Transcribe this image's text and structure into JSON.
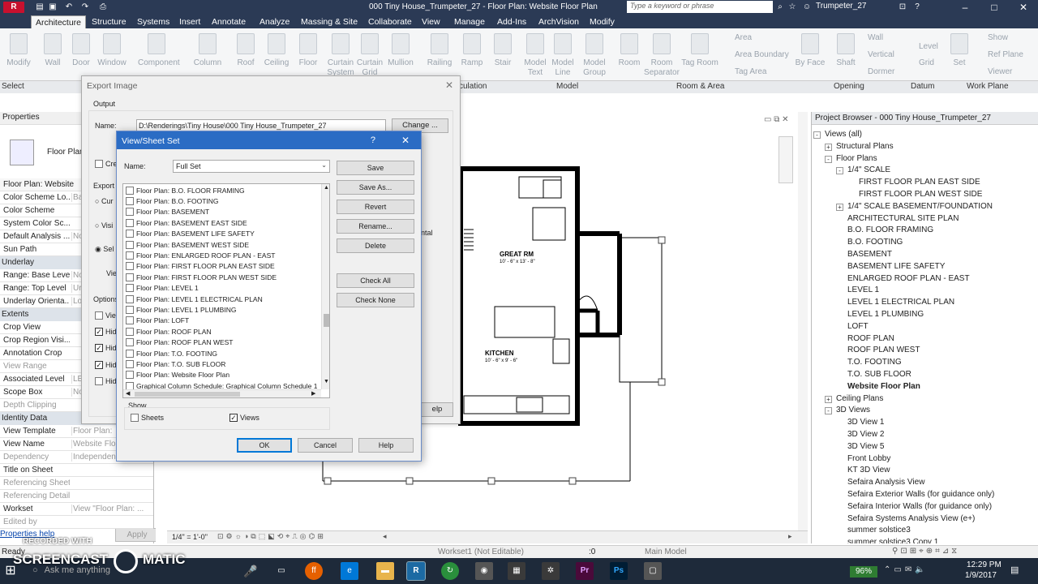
{
  "titlebar": {
    "title": "000 Tiny House_Trumpeter_27 - Floor Plan: Website Floor Plan",
    "search_placeholder": "Type a keyword or phrase",
    "user": "Trumpeter_27"
  },
  "tabs": [
    "Architecture",
    "Structure",
    "Systems",
    "Insert",
    "Annotate",
    "Analyze",
    "Massing & Site",
    "Collaborate",
    "View",
    "Manage",
    "Add-Ins",
    "ArchVision",
    "Modify"
  ],
  "ribbon": {
    "buttons": [
      "Modify",
      "Wall",
      "Door",
      "Window",
      "Component",
      "Column",
      "Roof",
      "Ceiling",
      "Floor",
      "Curtain System",
      "Curtain Grid",
      "Mullion",
      "Railing",
      "Ramp",
      "Stair",
      "Model Text",
      "Model Line",
      "Model Group",
      "Room",
      "Room Separator",
      "Tag Room",
      "By Face",
      "Shaft",
      "Set"
    ],
    "small": [
      "Area",
      "Area Boundary",
      "Tag Area",
      "Wall",
      "Vertical",
      "Dormer",
      "Level",
      "Grid",
      "Show",
      "Ref Plane",
      "Viewer"
    ],
    "groups": [
      "Select",
      "culation",
      "Model",
      "Room & Area",
      "Opening",
      "Datum",
      "Work Plane"
    ]
  },
  "properties": {
    "header": "Properties",
    "type": "Floor Plan",
    "selector": "Floor Plan: Website Fl",
    "rows": [
      {
        "k": "Color Scheme Lo...",
        "v": "Ba"
      },
      {
        "k": "Color Scheme",
        "v": ""
      },
      {
        "k": "System Color Sc...",
        "v": ""
      },
      {
        "k": "Default Analysis ...",
        "v": "No"
      },
      {
        "k": "Sun Path",
        "v": ""
      }
    ],
    "section_underlay": "Underlay",
    "underlay_rows": [
      {
        "k": "Range: Base Level",
        "v": "No"
      },
      {
        "k": "Range: Top Level",
        "v": "Ur"
      },
      {
        "k": "Underlay Orienta...",
        "v": "Lo"
      }
    ],
    "section_extents": "Extents",
    "extents_rows": [
      {
        "k": "Crop View",
        "v": ""
      },
      {
        "k": "Crop Region Visi...",
        "v": ""
      },
      {
        "k": "Annotation Crop",
        "v": ""
      },
      {
        "k": "View Range",
        "v": ""
      },
      {
        "k": "Associated Level",
        "v": "LE"
      },
      {
        "k": "Scope Box",
        "v": "No"
      },
      {
        "k": "Depth Clipping",
        "v": ""
      }
    ],
    "section_identity": "Identity Data",
    "identity_rows": [
      {
        "k": "View Template",
        "v": "Floor Plan:"
      },
      {
        "k": "View Name",
        "v": "Website Flo"
      },
      {
        "k": "Dependency",
        "v": "Independen"
      },
      {
        "k": "Title on Sheet",
        "v": ""
      },
      {
        "k": "Referencing Sheet",
        "v": ""
      },
      {
        "k": "Referencing Detail",
        "v": ""
      },
      {
        "k": "Workset",
        "v": "View \"Floor Plan: ..."
      },
      {
        "k": "Edited by",
        "v": ""
      }
    ],
    "help": "Properties help",
    "apply": "Apply"
  },
  "export": {
    "title": "Export Image",
    "output": "Output",
    "name_label": "Name:",
    "name_value": "D:\\Renderings\\Tiny House\\000 Tiny House_Trumpeter_27",
    "change": "Change ...",
    "cre": "Cre",
    "export_range": "Export R",
    "cur": "Cur",
    "visi": "Visi",
    "sel": "Sel",
    "view": "Vie",
    "options": "Options",
    "hide_labels": [
      "View",
      "Hide",
      "Hide",
      "Hide",
      "Hide"
    ],
    "ntal": "ntal",
    "help": "elp"
  },
  "vs": {
    "title": "View/Sheet Set",
    "help_q": "?",
    "name_label": "Name:",
    "name_value": "Full Set",
    "buttons": [
      "Save",
      "Save As...",
      "Revert",
      "Rename...",
      "Delete",
      "Check All",
      "Check None"
    ],
    "items": [
      "Floor Plan: B.O. FLOOR FRAMING",
      "Floor Plan: B.O. FOOTING",
      "Floor Plan: BASEMENT",
      "Floor Plan: BASEMENT EAST SIDE",
      "Floor Plan: BASEMENT LIFE SAFETY",
      "Floor Plan: BASEMENT WEST SIDE",
      "Floor Plan: ENLARGED ROOF PLAN - EAST",
      "Floor Plan: FIRST FLOOR PLAN EAST SIDE",
      "Floor Plan: FIRST FLOOR PLAN WEST SIDE",
      "Floor Plan: LEVEL 1",
      "Floor Plan: LEVEL 1 ELECTRICAL PLAN",
      "Floor Plan: LEVEL 1 PLUMBING",
      "Floor Plan: LOFT",
      "Floor Plan: ROOF PLAN",
      "Floor Plan: ROOF PLAN WEST",
      "Floor Plan: T.O. FOOTING",
      "Floor Plan: T.O. SUB FLOOR",
      "Floor Plan: Website Floor Plan",
      "Graphical Column Schedule: Graphical Column Schedule 1"
    ],
    "show": "Show",
    "sheets": "Sheets",
    "views": "Views",
    "ok": "OK",
    "cancel": "Cancel",
    "help": "Help"
  },
  "drawing": {
    "great_rm": "GREAT RM",
    "great_rm_dim": "10' - 6\" x 13' - 8\"",
    "kitchen": "KITCHEN",
    "kitchen_dim": "10' - 6\" x 9' - 6\"",
    "scale": "1/4\" = 1'-0\""
  },
  "browser": {
    "title": "Project Browser - 000 Tiny House_Trumpeter_27",
    "nodes": [
      {
        "t": "Views (all)",
        "lvl": 0,
        "g": "-"
      },
      {
        "t": "Structural Plans",
        "lvl": 1,
        "g": "+"
      },
      {
        "t": "Floor Plans",
        "lvl": 1,
        "g": "-"
      },
      {
        "t": "1/4\" SCALE",
        "lvl": 2,
        "g": "-"
      },
      {
        "t": "FIRST FLOOR PLAN EAST SIDE",
        "lvl": 3,
        "g": ""
      },
      {
        "t": "FIRST FLOOR PLAN WEST SIDE",
        "lvl": 3,
        "g": ""
      },
      {
        "t": "1/4\" SCALE BASEMENT/FOUNDATION",
        "lvl": 2,
        "g": "+"
      },
      {
        "t": "ARCHITECTURAL SITE PLAN",
        "lvl": 2,
        "g": ""
      },
      {
        "t": "B.O. FLOOR FRAMING",
        "lvl": 2,
        "g": ""
      },
      {
        "t": "B.O. FOOTING",
        "lvl": 2,
        "g": ""
      },
      {
        "t": "BASEMENT",
        "lvl": 2,
        "g": ""
      },
      {
        "t": "BASEMENT LIFE SAFETY",
        "lvl": 2,
        "g": ""
      },
      {
        "t": "ENLARGED ROOF PLAN - EAST",
        "lvl": 2,
        "g": ""
      },
      {
        "t": "LEVEL 1",
        "lvl": 2,
        "g": ""
      },
      {
        "t": "LEVEL 1 ELECTRICAL PLAN",
        "lvl": 2,
        "g": ""
      },
      {
        "t": "LEVEL 1 PLUMBING",
        "lvl": 2,
        "g": ""
      },
      {
        "t": "LOFT",
        "lvl": 2,
        "g": ""
      },
      {
        "t": "ROOF PLAN",
        "lvl": 2,
        "g": ""
      },
      {
        "t": "ROOF PLAN WEST",
        "lvl": 2,
        "g": ""
      },
      {
        "t": "T.O. FOOTING",
        "lvl": 2,
        "g": ""
      },
      {
        "t": "T.O. SUB FLOOR",
        "lvl": 2,
        "g": ""
      },
      {
        "t": "Website Floor Plan",
        "lvl": 2,
        "g": "",
        "bold": true
      },
      {
        "t": "Ceiling Plans",
        "lvl": 1,
        "g": "+"
      },
      {
        "t": "3D Views",
        "lvl": 1,
        "g": "-"
      },
      {
        "t": "3D View 1",
        "lvl": 2,
        "g": ""
      },
      {
        "t": "3D View 2",
        "lvl": 2,
        "g": ""
      },
      {
        "t": "3D View 5",
        "lvl": 2,
        "g": ""
      },
      {
        "t": "Front Lobby",
        "lvl": 2,
        "g": ""
      },
      {
        "t": "KT 3D View",
        "lvl": 2,
        "g": ""
      },
      {
        "t": "Sefaira Analysis View",
        "lvl": 2,
        "g": ""
      },
      {
        "t": "Sefaira Exterior Walls (for guidance only)",
        "lvl": 2,
        "g": ""
      },
      {
        "t": "Sefaira Interior Walls (for guidance only)",
        "lvl": 2,
        "g": ""
      },
      {
        "t": "Sefaira Systems Analysis View (e+)",
        "lvl": 2,
        "g": ""
      },
      {
        "t": "summer solstice3",
        "lvl": 2,
        "g": ""
      },
      {
        "t": "summer solstice3 Copy 1",
        "lvl": 2,
        "g": ""
      }
    ]
  },
  "status": {
    "ready": "Ready",
    "workset": "Workset1 (Not Editable)",
    "zero": ":0",
    "model": "Main Model"
  },
  "taskbar": {
    "search": "Ask me anything",
    "battery": "96%",
    "time": "12:29 PM",
    "date": "1/9/2017"
  },
  "watermark": {
    "line1": "RECORDED WITH",
    "line2": "SCREENCAST",
    "line3": "MATIC"
  }
}
